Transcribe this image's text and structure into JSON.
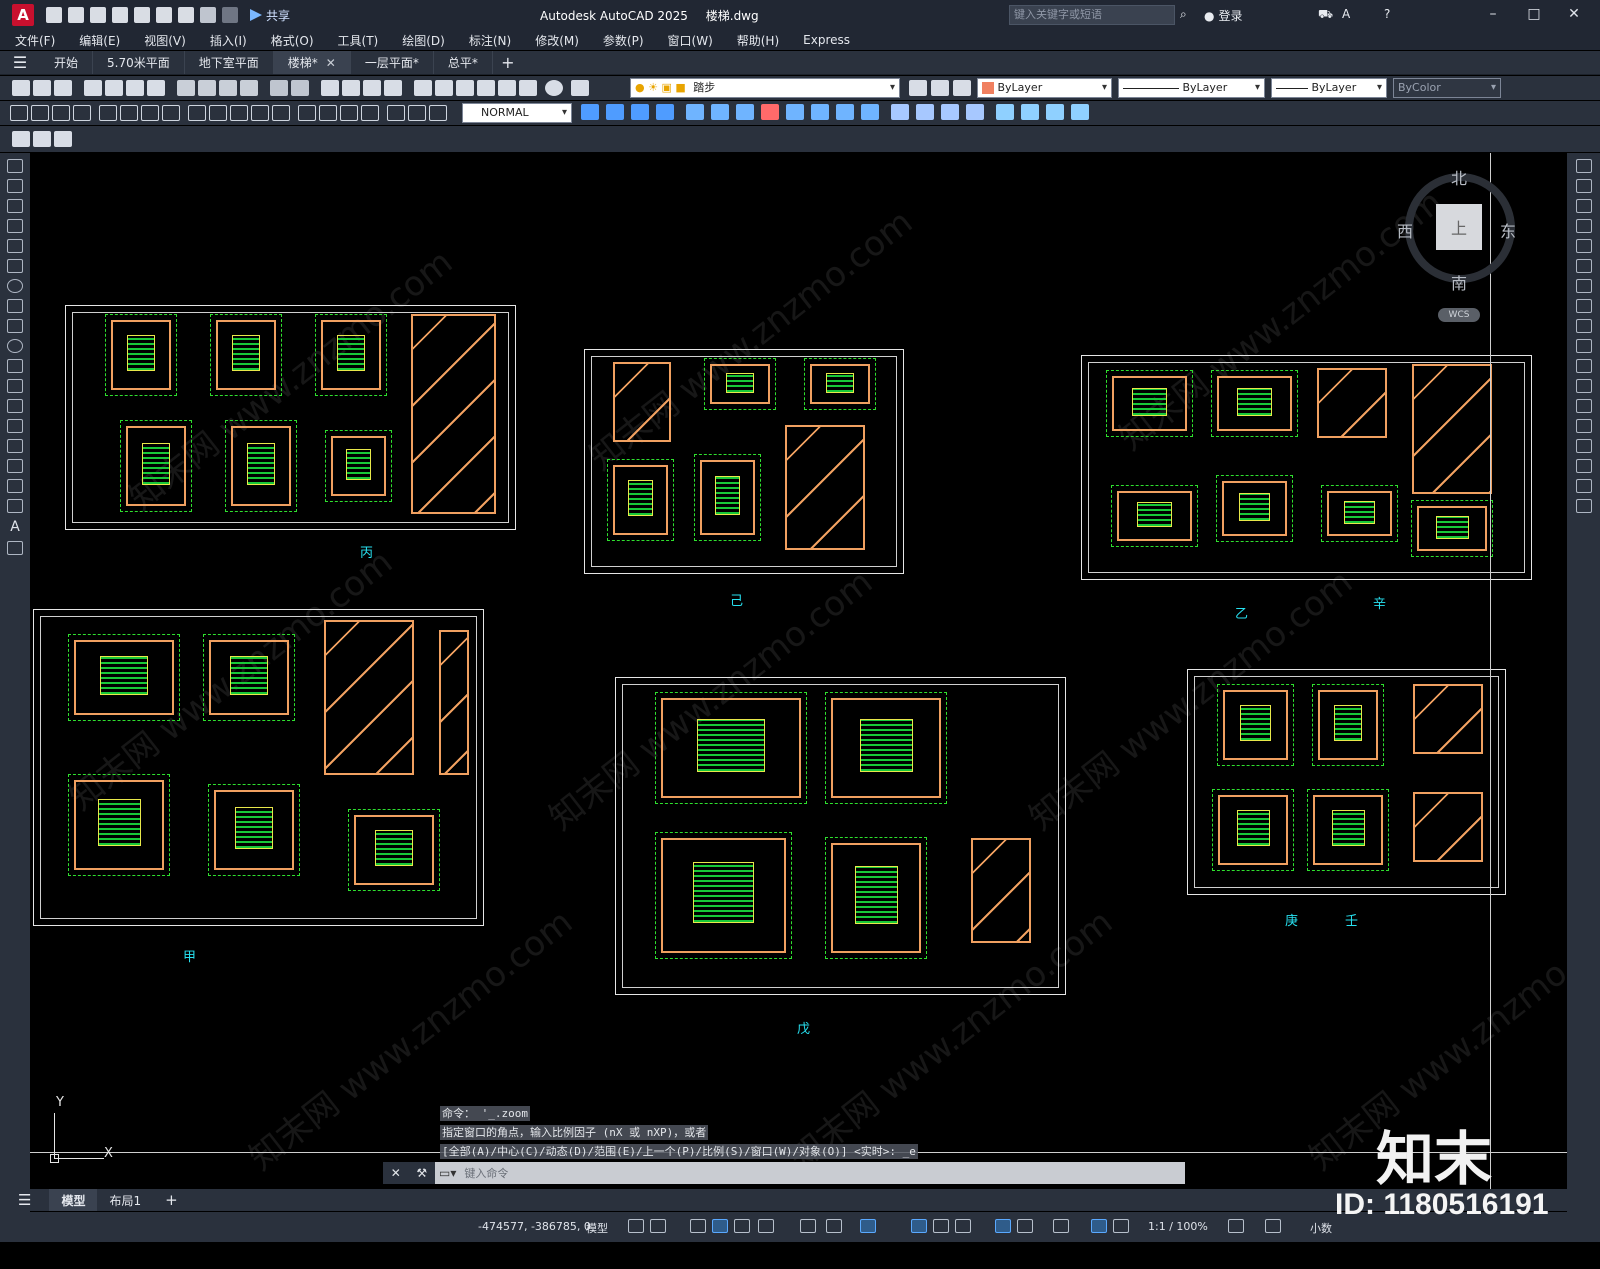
{
  "titlebar": {
    "logo": "A",
    "share": "共享",
    "app_name": "Autodesk AutoCAD 2025",
    "file_name": "楼梯.dwg",
    "search_placeholder": "键入关键字或短语",
    "login": "登录"
  },
  "menu": [
    "文件(F)",
    "编辑(E)",
    "视图(V)",
    "插入(I)",
    "格式(O)",
    "工具(T)",
    "绘图(D)",
    "标注(N)",
    "修改(M)",
    "参数(P)",
    "窗口(W)",
    "帮助(H)",
    "Express"
  ],
  "tabs": [
    {
      "label": "开始",
      "active": false
    },
    {
      "label": "5.70米平面",
      "active": false
    },
    {
      "label": "地下室平面",
      "active": false
    },
    {
      "label": "楼梯*",
      "active": true
    },
    {
      "label": "一层平面*",
      "active": false
    },
    {
      "label": "总平*",
      "active": false
    }
  ],
  "properties": {
    "layer": "踏步",
    "color": "ByLayer",
    "linetype": "ByLayer",
    "lineweight": "ByLayer",
    "plotstyle": "ByColor",
    "dimstyle": "NORMAL"
  },
  "viewcube": {
    "north": "北",
    "south": "南",
    "east": "东",
    "west": "西",
    "face": "上",
    "wcs": "WCS"
  },
  "sheets": [
    {
      "label": "丙"
    },
    {
      "label": "己"
    },
    {
      "label": "乙"
    },
    {
      "label": "辛"
    },
    {
      "label": "甲"
    },
    {
      "label": "戊"
    },
    {
      "label": "庚"
    },
    {
      "label": "壬"
    }
  ],
  "ucs": {
    "x": "X",
    "y": "Y"
  },
  "command_history": [
    "命令： '_.zoom",
    "指定窗口的角点，输入比例因子 (nX 或 nXP)，或者",
    "[全部(A)/中心(C)/动态(D)/范围(E)/上一个(P)/比例(S)/窗口(W)/对象(O)] <实时>: _e"
  ],
  "command_input_placeholder": "键入命令",
  "layout_tabs": [
    {
      "label": "模型",
      "active": true
    },
    {
      "label": "布局1",
      "active": false
    }
  ],
  "status": {
    "coords": "-474577, -386785, 0",
    "space": "模型",
    "scale": "1:1 / 100%",
    "units": "小数"
  },
  "watermark": {
    "logo": "知末",
    "id": "ID: 1180516191",
    "diagonal_text": "知末网 www.znzmo.com"
  },
  "colors": {
    "ui_bg": "#2a313d",
    "titlebar_bg": "#212733",
    "canvas_bg": "#000000",
    "wall": "#f0a060",
    "stair": "#18c838",
    "dims": "#2ee02e",
    "label": "#27e1f0",
    "color_swatch": "#f08060"
  }
}
